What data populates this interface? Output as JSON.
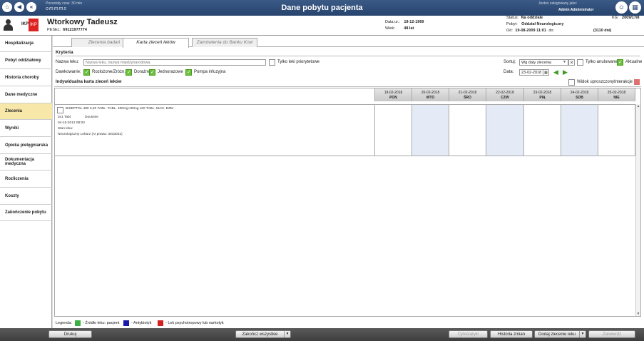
{
  "topbar": {
    "session_label": "Pozostały czas: 30 min",
    "logo": "ommms",
    "title": "Dane pobytu pacjenta",
    "logged_label": "Jesteś zalogowany jako:",
    "logged_user": "Admin Administrator",
    "nav_icons": [
      "home-icon",
      "back-icon",
      "rewind-icon"
    ],
    "right_icons": [
      "user-icon",
      "apps-grid-icon"
    ]
  },
  "patient": {
    "ikp": "IKP",
    "ikp_icon": "IKP",
    "name": "Wtorkowy Tadeusz",
    "pesel_label": "PESEL:",
    "pesel": "69121977774",
    "dob_label": "Data ur.:",
    "dob": "19-12-1969",
    "age_label": "Wiek:",
    "age": "48 lat",
    "status_label": "Status:",
    "status": "Na oddziale",
    "stay_label": "Pobyt:",
    "stay": "Oddział Neurologiczny",
    "from_label": "Od:",
    "from": "19-08-2009",
    "from_time": "11:01",
    "to_label": "do:",
    "days": "(3110 dni)",
    "kg_label": "KG:",
    "kg": "2009/17/8"
  },
  "sidebar": {
    "items": [
      {
        "label": "Hospitalizacja"
      },
      {
        "label": "Pobyt oddziałowy"
      },
      {
        "label": "Historia choroby"
      },
      {
        "label": "Dane medyczne"
      },
      {
        "label": "Zlecenia"
      },
      {
        "label": "Wyniki"
      },
      {
        "label": "Opieka pielęgniarska"
      },
      {
        "label": "Dokumentacja medyczna"
      },
      {
        "label": "Rozliczenia"
      },
      {
        "label": "Koszty"
      },
      {
        "label": "Zakończenie pobytu"
      }
    ],
    "active": "Zlecenia"
  },
  "tabs": [
    {
      "label": "Zlecenia badań"
    },
    {
      "label": "Karta zleceń leków"
    },
    {
      "label": "Zamówienia do Banku Krwi"
    }
  ],
  "criteria": {
    "title": "Kryteria",
    "drug_name_label": "Nazwa leku:",
    "drug_name_placeholder": "Nazwa leku, nazwa międzynarodowa",
    "priority_only_label": "Tylko leki priorytetowe",
    "sort_label": "Sortuj:",
    "sort_value": "Wg daty zlecenia",
    "cancelled_only_label": "Tylko anulowane",
    "current_label": "Aktualne",
    "dosing_label": "Dawkowanie:",
    "dosing_options": [
      "Rozłożone/Zróżn.",
      "Doraźne",
      "Jednorazowe",
      "Pompa infuzyjna"
    ],
    "date_label": "Data:",
    "date_value": "23-02-2018"
  },
  "card": {
    "title": "Indywidualna karta zleceń leków",
    "simplified_view_label": "Widok uproszczony",
    "interactions_label": "Interakcje",
    "interactions_color": "#e07070",
    "days": [
      {
        "date": "19-02-2018",
        "day": "PON"
      },
      {
        "date": "20-02-2018",
        "day": "WTO"
      },
      {
        "date": "21-02-2018",
        "day": "ŚRO"
      },
      {
        "date": "22-02-2018",
        "day": "CZW"
      },
      {
        "date": "23-02-2018",
        "day": "PIĄ"
      },
      {
        "date": "24-02-2018",
        "day": "SOB"
      },
      {
        "date": "25-02-2018",
        "day": "NIE"
      }
    ],
    "drug": {
      "name": "BISEPTOL 480 0,20 TABL. TABL. 400mg+80mg x20 TABL. MAG. DZM",
      "dose": "3x1 Tabl.",
      "route": "Doustnie",
      "ordered": "04-10-2012  08:00",
      "stock": "Stan leku:",
      "doctor": "Neurologiczny Lekarz (nr prawa: 3033031)"
    }
  },
  "legend": {
    "label": "Legenda:",
    "items": [
      {
        "color": "#3cb043",
        "text": "- Źródło leku: pacjent"
      },
      {
        "color": "#1a1aa8",
        "text": "- Antybiotyk"
      },
      {
        "color": "#d42020",
        "text": "- Lek psychotropowy lub narkotyk"
      }
    ]
  },
  "bottom": {
    "print": "Drukuj",
    "finish_all": "Zakończ wszystkie",
    "cytostatics": "Cytostatyki",
    "history": "Historia zmian",
    "add_order": "Dodaj zlecenie leku",
    "close": "Zatwierdź"
  }
}
